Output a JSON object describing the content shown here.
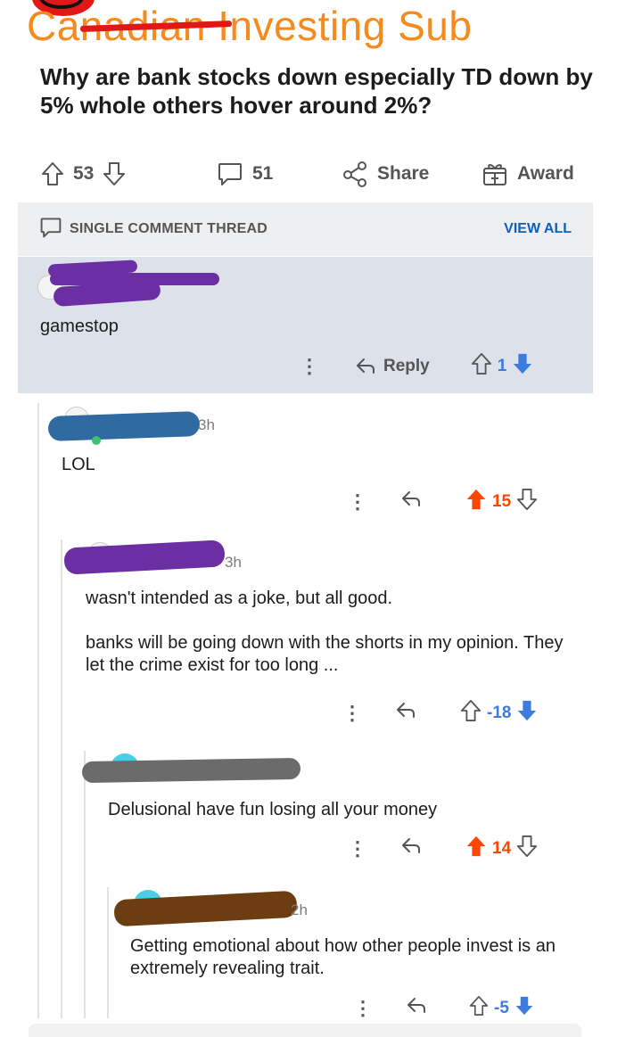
{
  "subreddit_banner": "Canadian Investing Sub",
  "post": {
    "title": "Why are bank stocks down especially TD down by 5% whole others hover around 2%?",
    "upvotes": "53",
    "comments": "51",
    "share_label": "Share",
    "award_label": "Award"
  },
  "thread": {
    "header_label": "SINGLE COMMENT THREAD",
    "view_all_label": "VIEW ALL"
  },
  "comments": [
    {
      "text": "gamestop",
      "reply_label": "Reply",
      "score": "1"
    },
    {
      "time": "3h",
      "text": "LOL",
      "score": "15"
    },
    {
      "time": "3h",
      "text": "wasn't intended as a joke, but all good.\n\nbanks will be going down with the shorts in my opinion.  They let the crime exist for too long ...",
      "score": "-18"
    },
    {
      "text": "Delusional have fun losing all your money",
      "score": "14"
    },
    {
      "time": "2h",
      "text": "Getting emotional about how other people invest is an extremely revealing trait.",
      "score": "-5"
    }
  ],
  "colors": {
    "banner_orange": "#f58a1f",
    "upvote_orange": "#ff4500",
    "downvote_blue": "#3d7bde",
    "link_blue": "#0f5fbf",
    "highlight_bg": "#dde2ea"
  }
}
